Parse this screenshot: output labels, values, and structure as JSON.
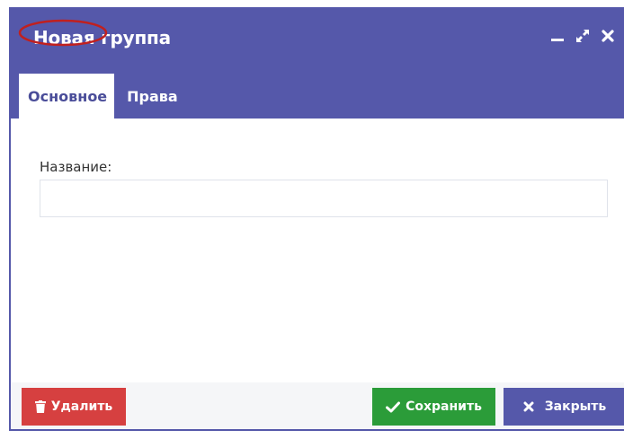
{
  "dialog": {
    "title": "Новая группа",
    "window_controls": [
      {
        "icon": "minimize-icon"
      },
      {
        "icon": "maximize-icon"
      },
      {
        "icon": "close-icon"
      }
    ]
  },
  "tabs": [
    {
      "label": "Основное",
      "active": true
    },
    {
      "label": "Права",
      "active": false
    }
  ],
  "form": {
    "name_label": "Название:",
    "name_value": "",
    "name_placeholder": ""
  },
  "footer": {
    "delete_label": "Удалить",
    "delete_icon": "trash-icon",
    "save_label": "Сохранить",
    "save_icon": "check-icon",
    "close_label": "Закрыть",
    "close_icon": "close-icon"
  },
  "colors": {
    "header": "#5558aa",
    "delete": "#d64040",
    "save": "#2b9c39",
    "close": "#5558aa",
    "highlight": "#c0201f"
  }
}
